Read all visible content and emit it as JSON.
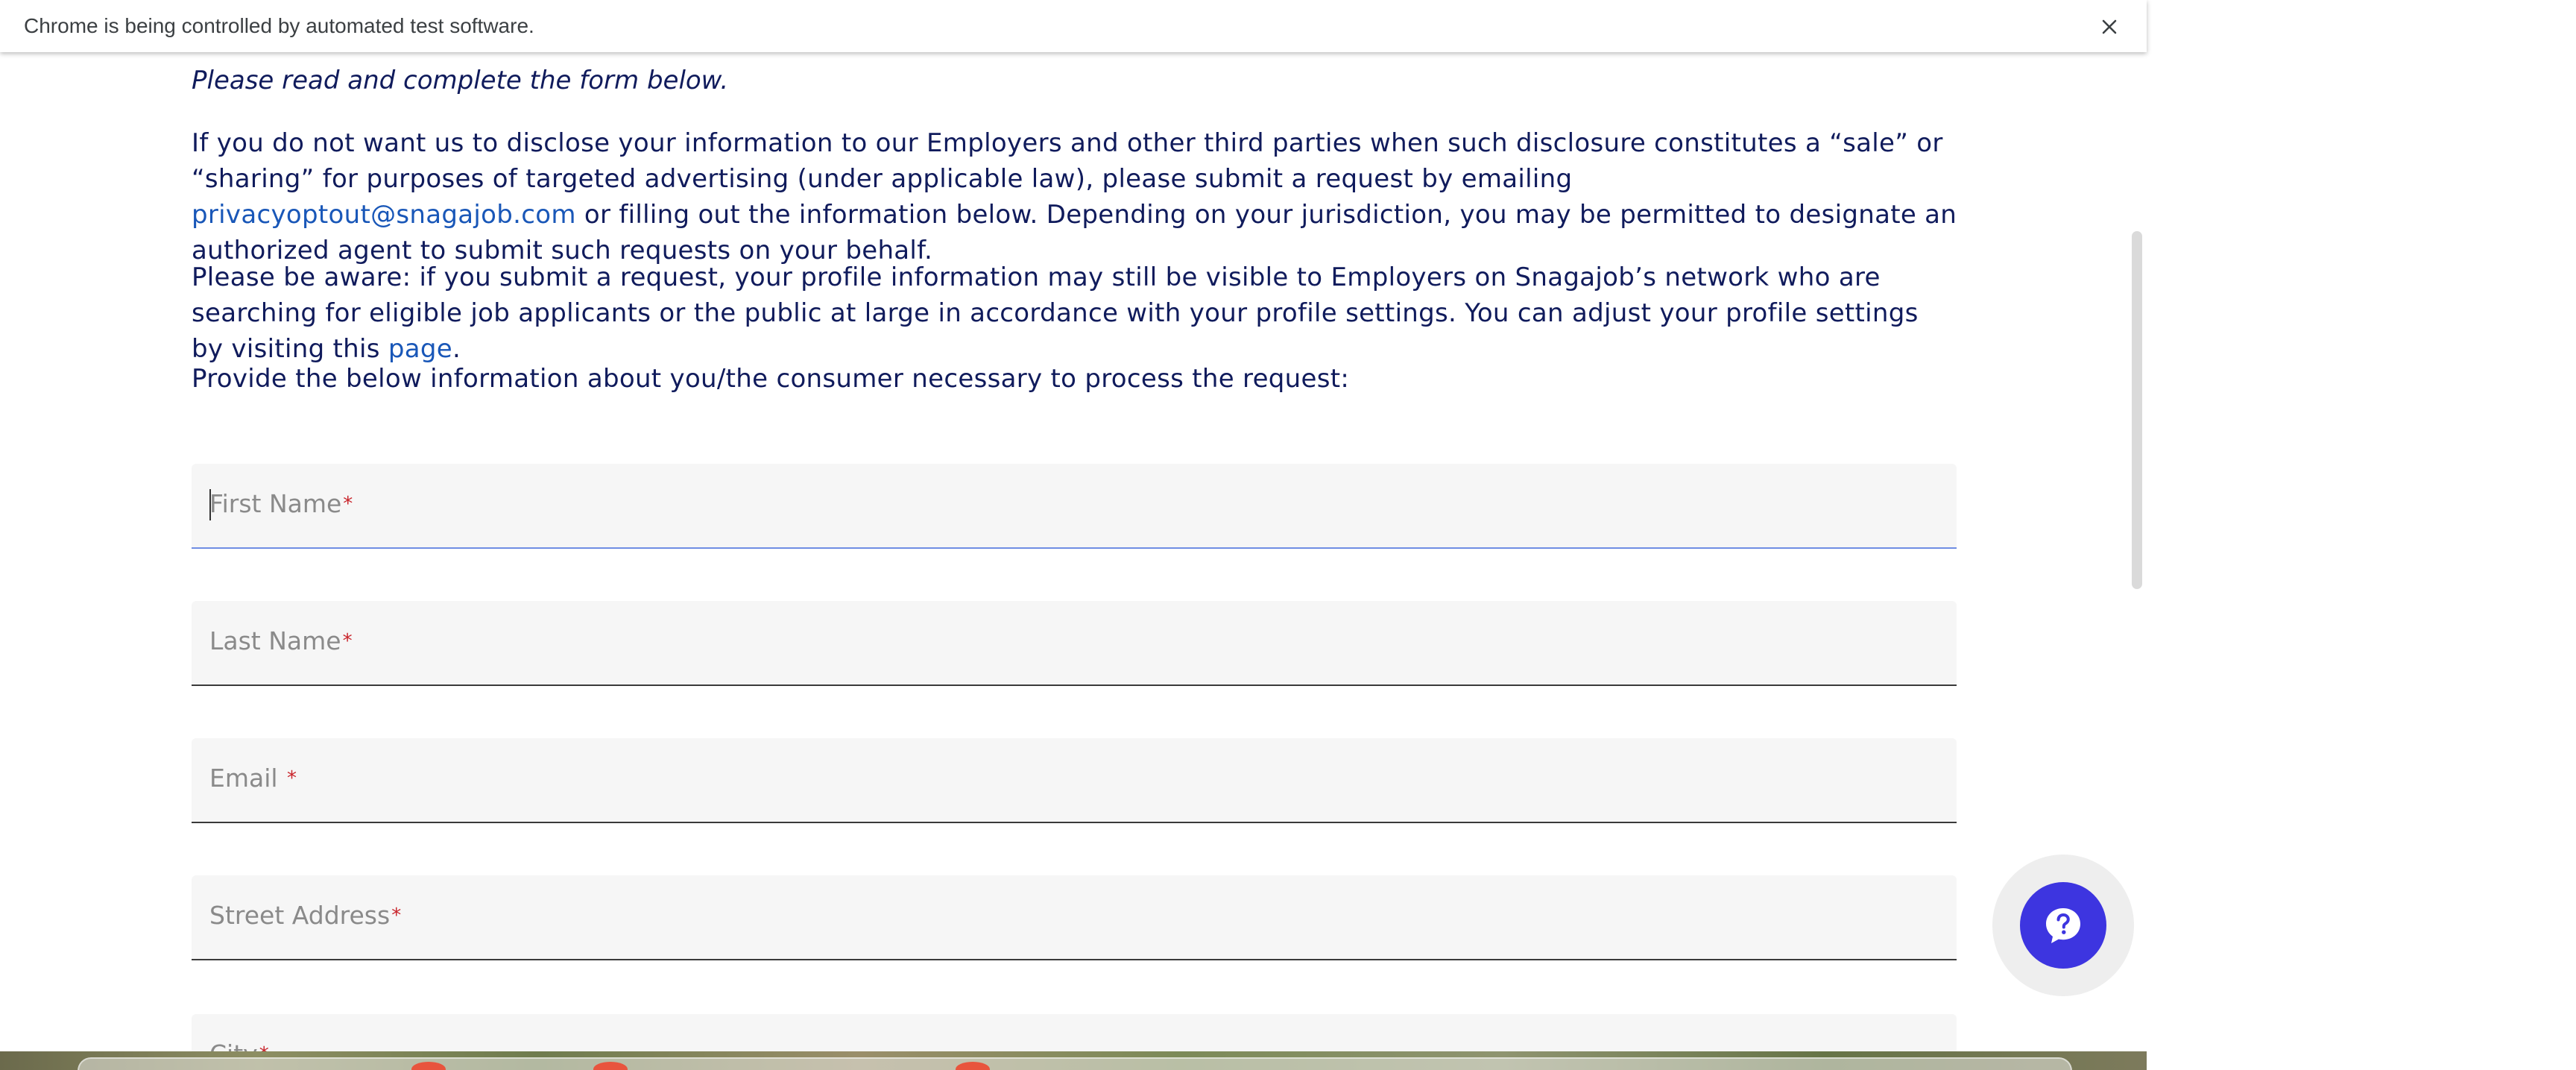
{
  "infobar": {
    "message": "Chrome is being controlled by automated test software.",
    "close_icon": "close-icon"
  },
  "page": {
    "intro": "Please read and complete the form below.",
    "p1_before_link": "If you do not want us to disclose your information to our Employers and other third parties when such disclosure constitutes a “sale” or “sharing” for purposes of targeted advertising (under applicable law), please submit a request by emailing ",
    "p1_link": "privacyoptout@snagajob.com",
    "p1_after_link": " or filling out the information below. Depending on your jurisdiction, you may be permitted to designate an authorized agent to submit such requests on your behalf.",
    "p2_before_link": "Please be aware: if you submit a request, your profile information may still be visible to Employers on Snagajob’s network who are searching for eligible job applicants or the public at large in accordance with your profile settings. You can adjust your profile settings by visiting this ",
    "p2_link": "page",
    "p2_after_link": ".",
    "p3": "Provide the below information about you/the consumer necessary to process the request:"
  },
  "form": {
    "required_marker": "*",
    "fields": [
      {
        "label": "First Name",
        "value": "",
        "focused": true
      },
      {
        "label": "Last Name",
        "value": "",
        "focused": false
      },
      {
        "label": "Email ",
        "value": "",
        "focused": false
      },
      {
        "label": "Street Address",
        "value": "",
        "focused": false
      },
      {
        "label": "City",
        "value": "",
        "focused": false
      }
    ]
  },
  "help_widget": {
    "icon": "help-question-icon",
    "color": "#3d35e0"
  },
  "colors": {
    "text": "#101b5c",
    "link": "#1957b8",
    "required": "#c9252c",
    "field_bg": "#f6f6f6"
  }
}
